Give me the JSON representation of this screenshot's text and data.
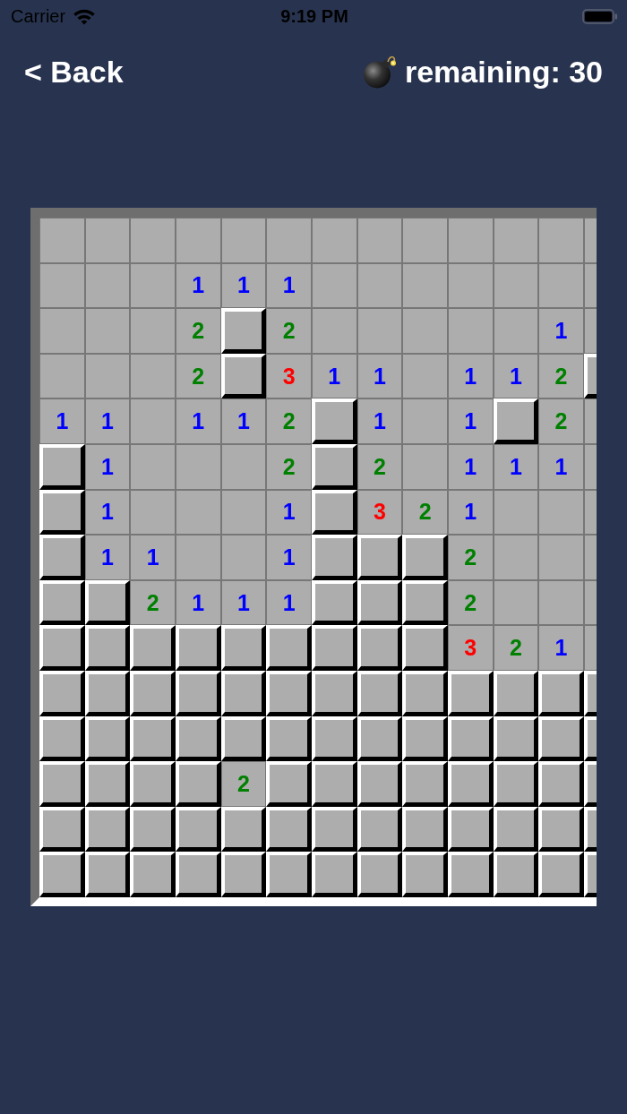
{
  "status_bar": {
    "carrier": "Carrier",
    "time": "9:19 PM"
  },
  "nav": {
    "back": "< Back",
    "remaining": "remaining: 30"
  },
  "board": {
    "rows": [
      [
        {
          "revealed": true
        },
        {
          "revealed": true
        },
        {
          "revealed": true
        },
        {
          "revealed": true
        },
        {
          "revealed": true
        },
        {
          "revealed": true
        },
        {
          "revealed": true
        },
        {
          "revealed": true
        },
        {
          "revealed": true
        },
        {
          "revealed": true
        },
        {
          "revealed": true
        },
        {
          "revealed": true
        },
        {
          "revealed": true
        }
      ],
      [
        {
          "revealed": true
        },
        {
          "revealed": true
        },
        {
          "revealed": true
        },
        {
          "revealed": true,
          "number": "1",
          "color": "#0000ff"
        },
        {
          "revealed": true,
          "number": "1",
          "color": "#0000ff"
        },
        {
          "revealed": true,
          "number": "1",
          "color": "#0000ff"
        },
        {
          "revealed": true
        },
        {
          "revealed": true
        },
        {
          "revealed": true
        },
        {
          "revealed": true
        },
        {
          "revealed": true
        },
        {
          "revealed": true
        },
        {
          "revealed": true
        }
      ],
      [
        {
          "revealed": true
        },
        {
          "revealed": true
        },
        {
          "revealed": true
        },
        {
          "revealed": true,
          "number": "2",
          "color": "#008000"
        },
        {
          "revealed": false
        },
        {
          "revealed": true,
          "number": "2",
          "color": "#008000"
        },
        {
          "revealed": true
        },
        {
          "revealed": true
        },
        {
          "revealed": true
        },
        {
          "revealed": true
        },
        {
          "revealed": true
        },
        {
          "revealed": true,
          "number": "1",
          "color": "#0000ff"
        },
        {
          "revealed": true
        }
      ],
      [
        {
          "revealed": true
        },
        {
          "revealed": true
        },
        {
          "revealed": true
        },
        {
          "revealed": true,
          "number": "2",
          "color": "#008000"
        },
        {
          "revealed": false
        },
        {
          "revealed": true,
          "number": "3",
          "color": "#ff0000"
        },
        {
          "revealed": true,
          "number": "1",
          "color": "#0000ff"
        },
        {
          "revealed": true,
          "number": "1",
          "color": "#0000ff"
        },
        {
          "revealed": true
        },
        {
          "revealed": true,
          "number": "1",
          "color": "#0000ff"
        },
        {
          "revealed": true,
          "number": "1",
          "color": "#0000ff"
        },
        {
          "revealed": true,
          "number": "2",
          "color": "#008000"
        },
        {
          "revealed": false
        }
      ],
      [
        {
          "revealed": true,
          "number": "1",
          "color": "#0000ff"
        },
        {
          "revealed": true,
          "number": "1",
          "color": "#0000ff"
        },
        {
          "revealed": true
        },
        {
          "revealed": true,
          "number": "1",
          "color": "#0000ff"
        },
        {
          "revealed": true,
          "number": "1",
          "color": "#0000ff"
        },
        {
          "revealed": true,
          "number": "2",
          "color": "#008000"
        },
        {
          "revealed": false
        },
        {
          "revealed": true,
          "number": "1",
          "color": "#0000ff"
        },
        {
          "revealed": true
        },
        {
          "revealed": true,
          "number": "1",
          "color": "#0000ff"
        },
        {
          "revealed": false
        },
        {
          "revealed": true,
          "number": "2",
          "color": "#008000"
        },
        {
          "revealed": true
        }
      ],
      [
        {
          "revealed": false
        },
        {
          "revealed": true,
          "number": "1",
          "color": "#0000ff"
        },
        {
          "revealed": true
        },
        {
          "revealed": true
        },
        {
          "revealed": true
        },
        {
          "revealed": true,
          "number": "2",
          "color": "#008000"
        },
        {
          "revealed": false
        },
        {
          "revealed": true,
          "number": "2",
          "color": "#008000"
        },
        {
          "revealed": true
        },
        {
          "revealed": true,
          "number": "1",
          "color": "#0000ff"
        },
        {
          "revealed": true,
          "number": "1",
          "color": "#0000ff"
        },
        {
          "revealed": true,
          "number": "1",
          "color": "#0000ff"
        },
        {
          "revealed": true
        }
      ],
      [
        {
          "revealed": false
        },
        {
          "revealed": true,
          "number": "1",
          "color": "#0000ff"
        },
        {
          "revealed": true
        },
        {
          "revealed": true
        },
        {
          "revealed": true
        },
        {
          "revealed": true,
          "number": "1",
          "color": "#0000ff"
        },
        {
          "revealed": false
        },
        {
          "revealed": true,
          "number": "3",
          "color": "#ff0000"
        },
        {
          "revealed": true,
          "number": "2",
          "color": "#008000"
        },
        {
          "revealed": true,
          "number": "1",
          "color": "#0000ff"
        },
        {
          "revealed": true
        },
        {
          "revealed": true
        },
        {
          "revealed": true
        }
      ],
      [
        {
          "revealed": false
        },
        {
          "revealed": true,
          "number": "1",
          "color": "#0000ff"
        },
        {
          "revealed": true,
          "number": "1",
          "color": "#0000ff"
        },
        {
          "revealed": true
        },
        {
          "revealed": true
        },
        {
          "revealed": true,
          "number": "1",
          "color": "#0000ff"
        },
        {
          "revealed": false
        },
        {
          "revealed": false
        },
        {
          "revealed": false
        },
        {
          "revealed": true,
          "number": "2",
          "color": "#008000"
        },
        {
          "revealed": true
        },
        {
          "revealed": true
        },
        {
          "revealed": true
        }
      ],
      [
        {
          "revealed": false
        },
        {
          "revealed": false
        },
        {
          "revealed": true,
          "number": "2",
          "color": "#008000"
        },
        {
          "revealed": true,
          "number": "1",
          "color": "#0000ff"
        },
        {
          "revealed": true,
          "number": "1",
          "color": "#0000ff"
        },
        {
          "revealed": true,
          "number": "1",
          "color": "#0000ff"
        },
        {
          "revealed": false
        },
        {
          "revealed": false
        },
        {
          "revealed": false
        },
        {
          "revealed": true,
          "number": "2",
          "color": "#008000"
        },
        {
          "revealed": true
        },
        {
          "revealed": true
        },
        {
          "revealed": true
        }
      ],
      [
        {
          "revealed": false
        },
        {
          "revealed": false
        },
        {
          "revealed": false
        },
        {
          "revealed": false
        },
        {
          "revealed": false
        },
        {
          "revealed": false
        },
        {
          "revealed": false
        },
        {
          "revealed": false
        },
        {
          "revealed": false
        },
        {
          "revealed": true,
          "number": "3",
          "color": "#ff0000"
        },
        {
          "revealed": true,
          "number": "2",
          "color": "#008000"
        },
        {
          "revealed": true,
          "number": "1",
          "color": "#0000ff"
        },
        {
          "revealed": true
        }
      ],
      [
        {
          "revealed": false
        },
        {
          "revealed": false
        },
        {
          "revealed": false
        },
        {
          "revealed": false
        },
        {
          "revealed": false
        },
        {
          "revealed": false
        },
        {
          "revealed": false
        },
        {
          "revealed": false
        },
        {
          "revealed": false
        },
        {
          "revealed": false
        },
        {
          "revealed": false
        },
        {
          "revealed": false
        },
        {
          "revealed": false
        }
      ],
      [
        {
          "revealed": false
        },
        {
          "revealed": false
        },
        {
          "revealed": false
        },
        {
          "revealed": false
        },
        {
          "revealed": false
        },
        {
          "revealed": false
        },
        {
          "revealed": false
        },
        {
          "revealed": false
        },
        {
          "revealed": false
        },
        {
          "revealed": false
        },
        {
          "revealed": false
        },
        {
          "revealed": false
        },
        {
          "revealed": false
        }
      ],
      [
        {
          "revealed": false
        },
        {
          "revealed": false
        },
        {
          "revealed": false
        },
        {
          "revealed": false
        },
        {
          "revealed": true,
          "number": "2",
          "color": "#008000"
        },
        {
          "revealed": false
        },
        {
          "revealed": false
        },
        {
          "revealed": false
        },
        {
          "revealed": false
        },
        {
          "revealed": false
        },
        {
          "revealed": false
        },
        {
          "revealed": false
        },
        {
          "revealed": false
        }
      ],
      [
        {
          "revealed": false
        },
        {
          "revealed": false
        },
        {
          "revealed": false
        },
        {
          "revealed": false
        },
        {
          "revealed": false
        },
        {
          "revealed": false
        },
        {
          "revealed": false
        },
        {
          "revealed": false
        },
        {
          "revealed": false
        },
        {
          "revealed": false
        },
        {
          "revealed": false
        },
        {
          "revealed": false
        },
        {
          "revealed": false
        }
      ],
      [
        {
          "revealed": false
        },
        {
          "revealed": false
        },
        {
          "revealed": false
        },
        {
          "revealed": false
        },
        {
          "revealed": false
        },
        {
          "revealed": false
        },
        {
          "revealed": false
        },
        {
          "revealed": false
        },
        {
          "revealed": false
        },
        {
          "revealed": false
        },
        {
          "revealed": false
        },
        {
          "revealed": false
        },
        {
          "revealed": false
        }
      ]
    ]
  }
}
